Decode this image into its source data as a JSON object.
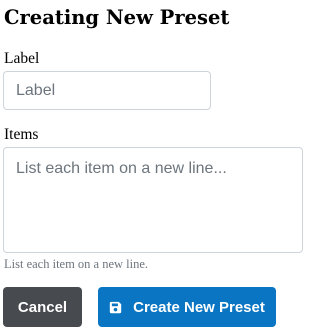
{
  "page": {
    "title": "Creating New Preset"
  },
  "form": {
    "label_field": {
      "label": "Label",
      "placeholder": "Label",
      "value": ""
    },
    "items_field": {
      "label": "Items",
      "placeholder": "List each item on a new line...",
      "value": "",
      "help_text": "List each item on a new line."
    }
  },
  "actions": {
    "cancel_label": "Cancel",
    "create_label": "Create New Preset",
    "create_icon": "save-icon"
  },
  "colors": {
    "cancel_bg": "#474a4f",
    "primary": "#0a75c2",
    "border": "#ced4da",
    "muted_text": "#6c757d"
  }
}
